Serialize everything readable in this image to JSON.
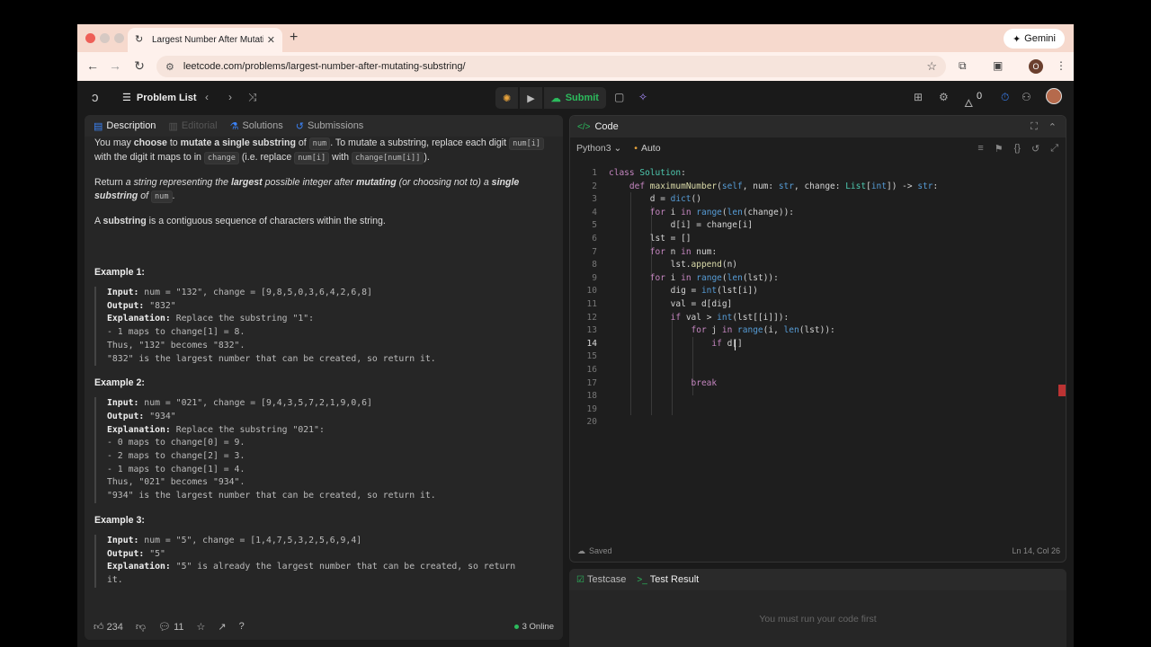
{
  "browser": {
    "tab_title": "Largest Number After Mutatin",
    "url": "leetcode.com/problems/largest-number-after-mutating-substring/",
    "gemini_label": "Gemini",
    "profile_initial": "O"
  },
  "nav": {
    "problem_list": "Problem List",
    "submit": "Submit",
    "streak_count": "0"
  },
  "left_tabs": {
    "description": "Description",
    "editorial": "Editorial",
    "solutions": "Solutions",
    "submissions": "Submissions"
  },
  "description": {
    "p1_a": "You may ",
    "p1_b": "choose",
    "p1_c": " to ",
    "p1_d": "mutate a single substring",
    "p1_e": " of ",
    "p1_f": "num",
    "p1_g": ". To mutate a substring, replace each digit ",
    "p1_h": "num[i]",
    "p1_i": " with the digit it maps to in ",
    "p1_j": "change",
    "p1_k": " (i.e. replace ",
    "p1_l": "num[i]",
    "p1_m": " with ",
    "p1_n": "change[num[i]]",
    "p1_o": ").",
    "p2_a": "Return ",
    "p2_b": "a string representing the ",
    "p2_c": "largest",
    "p2_d": " possible integer after ",
    "p2_e": "mutating",
    "p2_f": " (or choosing not to) a ",
    "p2_g": "single substring",
    "p2_h": " of ",
    "p2_i": "num",
    "p2_j": ".",
    "p3_a": "A ",
    "p3_b": "substring",
    "p3_c": " is a contiguous sequence of characters within the string."
  },
  "examples": [
    {
      "title": "Example 1:",
      "input": "num = \"132\", change = [9,8,5,0,3,6,4,2,6,8]",
      "output": "\"832\"",
      "explanation": "Replace the substring \"1\":",
      "lines": [
        "- 1 maps to change[1] = 8.",
        "Thus, \"132\" becomes \"832\".",
        "\"832\" is the largest number that can be created, so return it."
      ]
    },
    {
      "title": "Example 2:",
      "input": "num = \"021\", change = [9,4,3,5,7,2,1,9,0,6]",
      "output": "\"934\"",
      "explanation": "Replace the substring \"021\":",
      "lines": [
        "- 0 maps to change[0] = 9.",
        "- 2 maps to change[2] = 3.",
        "- 1 maps to change[1] = 4.",
        "Thus, \"021\" becomes \"934\".",
        "\"934\" is the largest number that can be created, so return it."
      ]
    },
    {
      "title": "Example 3:",
      "input": "num = \"5\", change = [1,4,7,5,3,2,5,6,9,4]",
      "output": "\"5\"",
      "explanation": "\"5\" is already the largest number that can be created, so return",
      "lines": [
        "it."
      ]
    }
  ],
  "labels": {
    "input": "Input:",
    "output": "Output:",
    "explanation": "Explanation:"
  },
  "footer": {
    "likes": "234",
    "comments": "11",
    "online": "3 Online"
  },
  "code_panel": {
    "title": "Code",
    "language": "Python3",
    "auto": "Auto",
    "saved": "Saved",
    "cursor_pos": "Ln 14, Col 26"
  },
  "code_lines": [
    "class Solution:",
    "    def maximumNumber(self, num: str, change: List[int]) -> str:",
    "        d = dict()",
    "        for i in range(len(change)):",
    "            d[i] = change[i]",
    "        lst = []",
    "        for n in num:",
    "            lst.append(n)",
    "        for i in range(len(lst)):",
    "            dig = int(lst[i])",
    "            val = d[dig]",
    "            if val > int(lst[[i]]):",
    "                for j in range(i, len(lst)):",
    "                    if d[]",
    "",
    "",
    "                break",
    "",
    "",
    ""
  ],
  "current_line": 14,
  "test_panel": {
    "testcase": "Testcase",
    "test_result": "Test Result",
    "message": "You must run your code first"
  },
  "colors": {
    "accent_green": "#2cbb5d",
    "keyword": "#c586c0",
    "builtin": "#569cd6",
    "function": "#dcdcaa",
    "type": "#4ec9b0"
  }
}
